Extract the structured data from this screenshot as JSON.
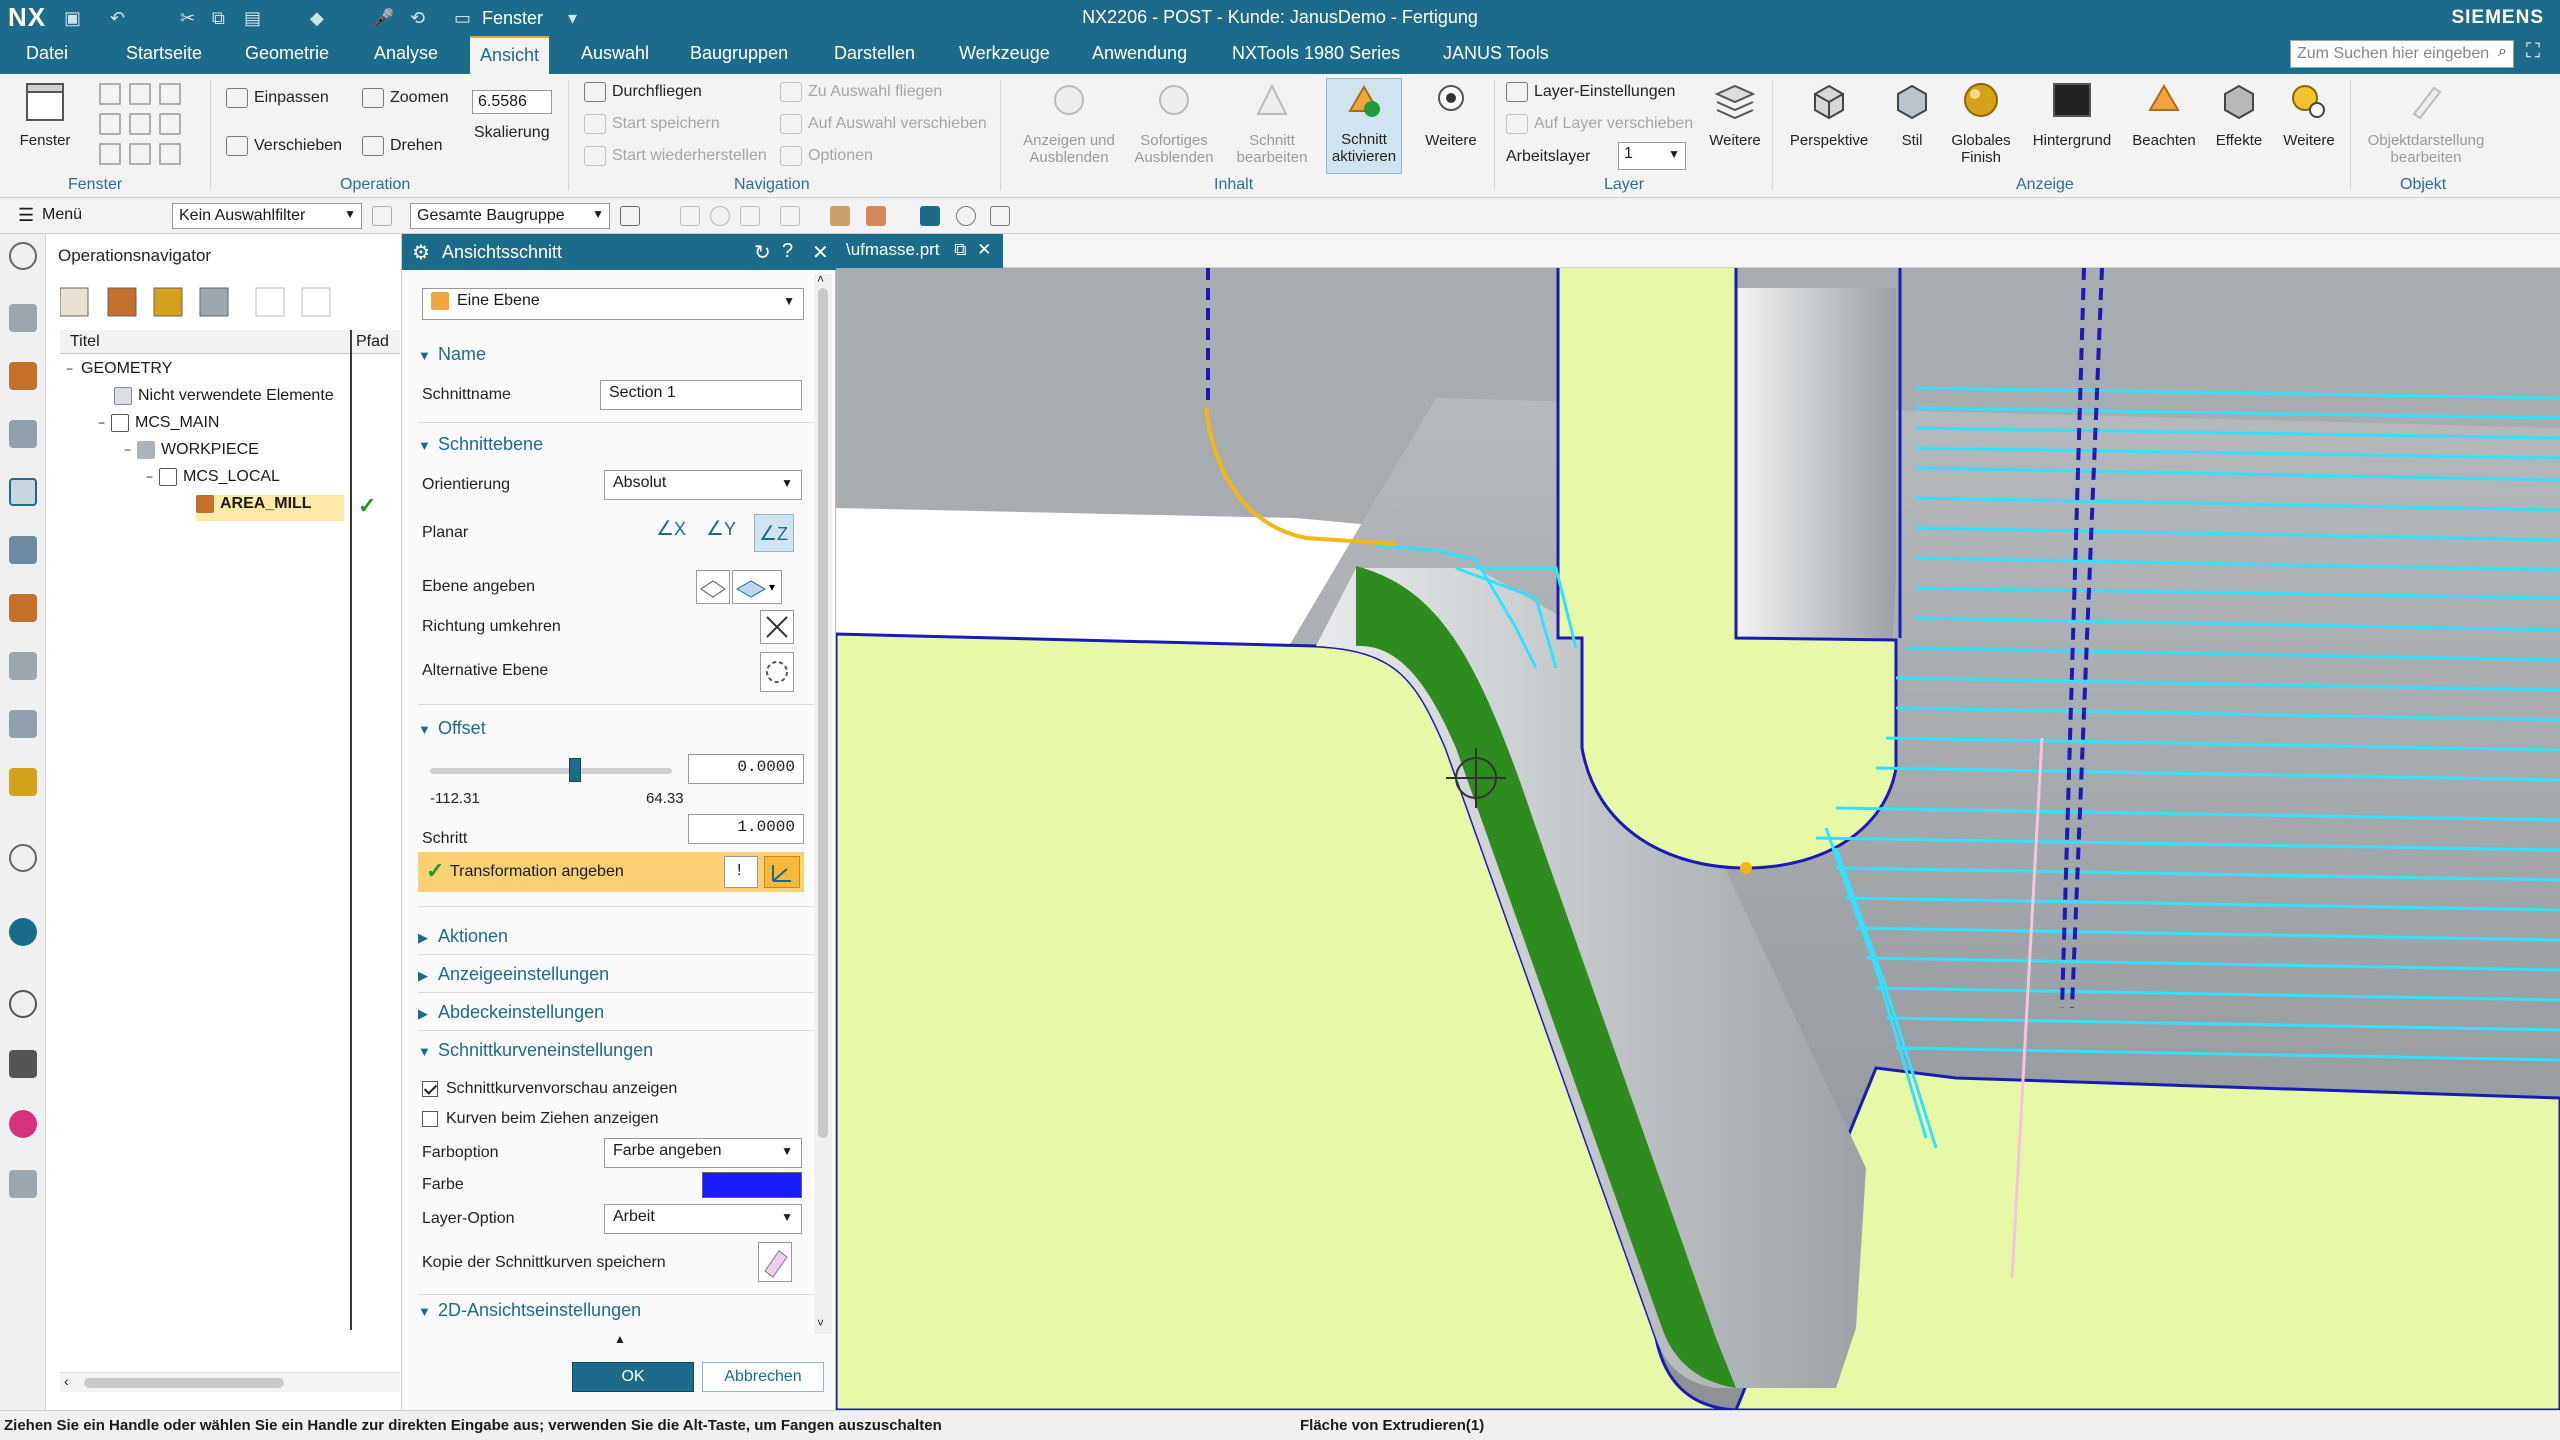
{
  "app": {
    "logo": "NX",
    "window_title": "NX2206 - POST - Kunde: JanusDemo - Fertigung",
    "brand": "SIEMENS",
    "quick_window_menu": "Fenster"
  },
  "tabs": [
    "Datei",
    "Startseite",
    "Geometrie",
    "Analyse",
    "Ansicht",
    "Auswahl",
    "Baugruppen",
    "Darstellen",
    "Werkzeuge",
    "Anwendung",
    "NXTools 1980 Series",
    "JANUS Tools"
  ],
  "active_tab": "Ansicht",
  "search_placeholder": "Zum Suchen hier eingeben",
  "ribbon": {
    "fenster": {
      "big": "Fenster",
      "group": "Fenster"
    },
    "operation": {
      "einpassen": "Einpassen",
      "verschieben": "Verschieben",
      "zoomen": "Zoomen",
      "drehen": "Drehen",
      "scale_value": "6.5586",
      "skalierung": "Skalierung",
      "group": "Operation"
    },
    "navigation": {
      "durchfliegen": "Durchfliegen",
      "start_speichern": "Start speichern",
      "start_wiederherstellen": "Start wiederherstellen",
      "zu_auswahl_fliegen": "Zu Auswahl fliegen",
      "auf_auswahl_verschieben": "Auf Auswahl verschieben",
      "optionen": "Optionen",
      "group": "Navigation"
    },
    "inhalt": {
      "anzeigen_ausblenden": [
        "Anzeigen und",
        "Ausblenden"
      ],
      "sofortiges": [
        "Sofortiges",
        "Ausblenden"
      ],
      "schnitt_bearbeiten": [
        "Schnitt",
        "bearbeiten"
      ],
      "schnitt_aktivieren": [
        "Schnitt",
        "aktivieren"
      ],
      "weitere": "Weitere",
      "group": "Inhalt"
    },
    "layer": {
      "layer_einstellungen": "Layer-Einstellungen",
      "auf_layer_verschieben": "Auf Layer verschieben",
      "arbeitslayer": "Arbeitslayer",
      "arbeitslayer_value": "1",
      "weitere": "Weitere",
      "group": "Layer"
    },
    "anzeige": {
      "perspektive": "Perspektive",
      "stil": "Stil",
      "globales_finish": [
        "Globales",
        "Finish"
      ],
      "hintergrund": "Hintergrund",
      "beachten": "Beachten",
      "effekte": "Effekte",
      "weitere": "Weitere",
      "group": "Anzeige"
    },
    "objekt": {
      "objektdarstellung": [
        "Objektdarstellung",
        "bearbeiten"
      ],
      "group": "Objekt"
    }
  },
  "toolbar2": {
    "menu": "Menü",
    "filter": "Kein Auswahlfilter",
    "scope": "Gesamte Baugruppe"
  },
  "navigator": {
    "title": "Operationsnavigator",
    "columns": [
      "Titel",
      "Pfad"
    ],
    "rows": [
      {
        "label": "GEOMETRY",
        "indent": 0,
        "expander": "−"
      },
      {
        "label": "Nicht verwendete Elemente",
        "indent": 1,
        "expander": ""
      },
      {
        "label": "MCS_MAIN",
        "indent": 1,
        "expander": "−"
      },
      {
        "label": "WORKPIECE",
        "indent": 2,
        "expander": "−"
      },
      {
        "label": "MCS_LOCAL",
        "indent": 3,
        "expander": "−"
      },
      {
        "label": "AREA_MILL",
        "indent": 4,
        "expander": "",
        "selected": true,
        "check": "✓"
      }
    ]
  },
  "dialog": {
    "title": "Ansichtsschnitt",
    "type_value": "Eine Ebene",
    "sections": {
      "name": "Name",
      "schnittebene": "Schnittebene",
      "offset": "Offset",
      "aktionen": "Aktionen",
      "anzeigeeinstellungen": "Anzeigeeinstellungen",
      "abdeckeinstellungen": "Abdeckeinstellungen",
      "schnittkurveneinstellungen": "Schnittkurveneinstellungen",
      "ansichtseinstellungen_2d": "2D-Ansichtseinstellungen"
    },
    "schnittname_label": "Schnittname",
    "schnittname_value": "Section 1",
    "orientierung_label": "Orientierung",
    "orientierung_value": "Absolut",
    "planar_label": "Planar",
    "planar_axes": [
      "X",
      "Y",
      "Z"
    ],
    "ebene_angeben_label": "Ebene angeben",
    "richtung_umkehren_label": "Richtung umkehren",
    "alternative_ebene_label": "Alternative Ebene",
    "offset_value": "0.0000",
    "slider_min": "-112.31",
    "slider_max": "64.33",
    "slider_fraction": 0.6,
    "schritt_label": "Schritt",
    "schritt_value": "1.0000",
    "transformation_label": "Transformation angeben",
    "chk_vorschau": "Schnittkurvenvorschau anzeigen",
    "chk_ziehen": "Kurven beim Ziehen anzeigen",
    "farboption_label": "Farboption",
    "farboption_value": "Farbe angeben",
    "farbe_label": "Farbe",
    "farbe_color": "#1a1aff",
    "layer_option_label": "Layer-Option",
    "layer_option_value": "Arbeit",
    "kopie_label": "Kopie der Schnittkurven speichern",
    "ok": "OK",
    "cancel": "Abbrechen"
  },
  "viewport": {
    "tab_name": "\\ufmasse.prt"
  },
  "statusbar": {
    "left": "Ziehen Sie ein Handle oder wählen Sie ein Handle zur direkten Eingabe aus; verwenden Sie die Alt-Taste, um Fangen auszuschalten",
    "middle": "Fläche von Extrudieren(1)"
  },
  "colors": {
    "title_bar": "#1d6b8b",
    "accent_tab": "#f1a11e",
    "section_plane": "#e6f7a6",
    "toolpath_cyan": "#33e0ff",
    "edge_blue": "#1a1ab4",
    "green_face": "#2e8b1e"
  }
}
